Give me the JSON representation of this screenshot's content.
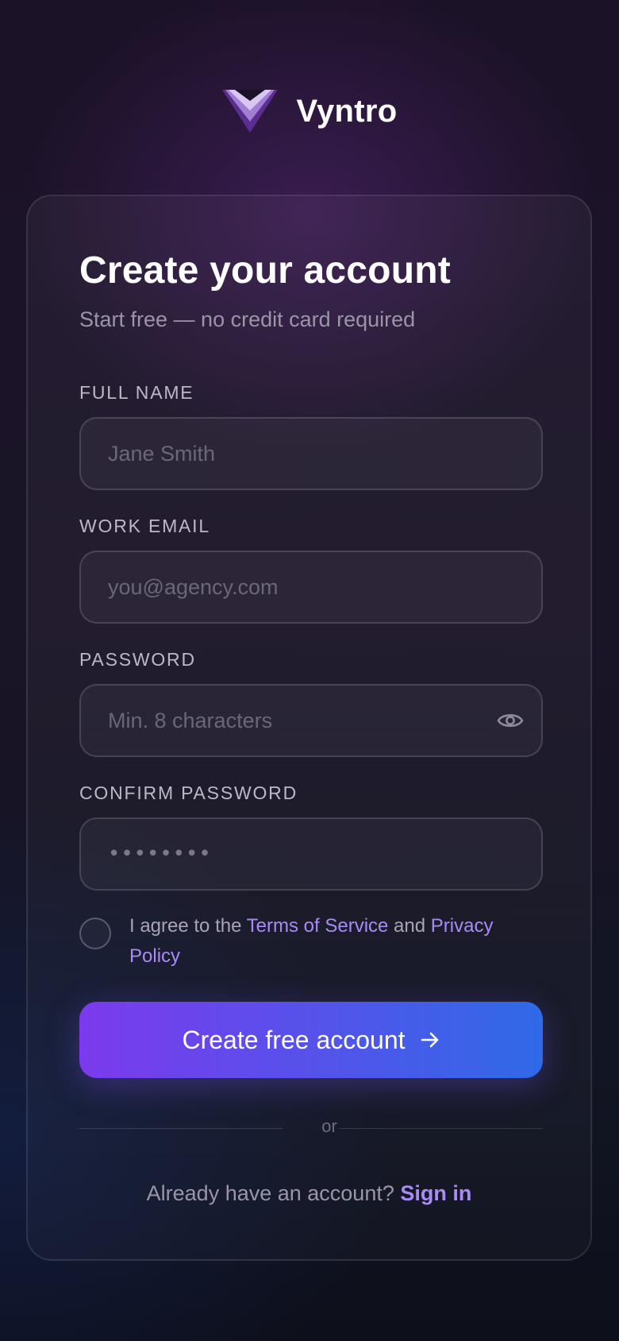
{
  "brand": {
    "name": "Vyntro",
    "logo_icon": "v-chevron-logo-icon"
  },
  "form": {
    "title": "Create your account",
    "subtitle": "Start free — no credit card required",
    "full_name": {
      "label": "FULL NAME",
      "placeholder": "Jane Smith",
      "value": ""
    },
    "work_email": {
      "label": "WORK EMAIL",
      "placeholder": "you@agency.com",
      "value": ""
    },
    "password": {
      "label": "PASSWORD",
      "placeholder": "Min. 8 characters",
      "value": "",
      "toggle_icon": "eye-icon"
    },
    "confirm_password": {
      "label": "CONFIRM PASSWORD",
      "masked_value": "••••••••"
    },
    "terms": {
      "checked": false,
      "prefix": "I agree to the ",
      "terms_link": "Terms of Service",
      "middle": " and ",
      "privacy_link": "Privacy Policy"
    },
    "submit": {
      "label": "Create free account",
      "icon": "arrow-right-icon"
    },
    "divider": "or",
    "signin": {
      "prompt": "Already have an account? ",
      "link": "Sign in"
    }
  },
  "colors": {
    "accent_start": "#7c3aed",
    "accent_end": "#2f6ae8",
    "link": "#a98bf5"
  }
}
